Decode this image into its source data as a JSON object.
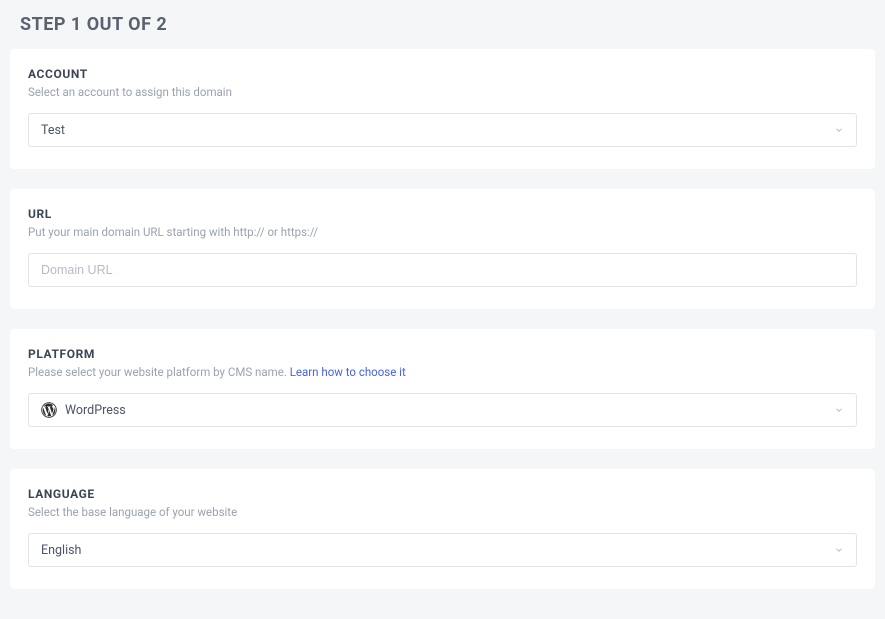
{
  "step_header": "STEP 1 OUT OF 2",
  "account": {
    "title": "ACCOUNT",
    "desc": "Select an account to assign this domain",
    "selected": "Test"
  },
  "url": {
    "title": "URL",
    "desc": "Put your main domain URL starting with http:// or https://",
    "placeholder": "Domain URL"
  },
  "platform": {
    "title": "PLATFORM",
    "desc_pre": "Please select your website platform by CMS name.  ",
    "link_text": "Learn how to choose it",
    "selected": "WordPress"
  },
  "language": {
    "title": "LANGUAGE",
    "desc": "Select the base language of your website",
    "selected": "English"
  }
}
